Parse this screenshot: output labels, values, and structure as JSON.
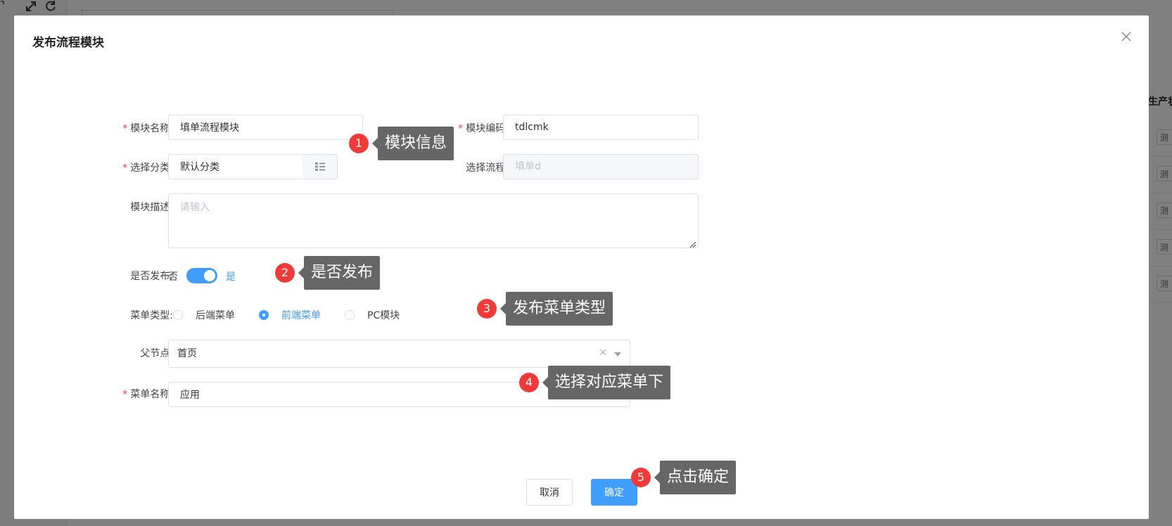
{
  "background": {
    "toolbar_icons": [
      "expand-icon",
      "refresh-icon"
    ],
    "right_column_header": "生产状",
    "right_row_tags": [
      "测",
      "测",
      "测",
      "测",
      "测"
    ]
  },
  "modal": {
    "title": "发布流程模块",
    "close_icon": "close-icon"
  },
  "form": {
    "module_name": {
      "label": "模块名称:",
      "required": true,
      "value": "填单流程模块"
    },
    "module_code": {
      "label": "模块编码:",
      "required": true,
      "value": "tdlcmk"
    },
    "category": {
      "label": "选择分类:",
      "required": true,
      "value": "默认分类",
      "append_icon": "list-icon"
    },
    "process": {
      "label": "选择流程:",
      "placeholder": "填单d",
      "disabled": true
    },
    "description": {
      "label": "模块描述:",
      "placeholder": "请输入"
    },
    "publish": {
      "label": "是否发布:",
      "off_text": "否",
      "on_text": "是",
      "on": true
    },
    "menu_type": {
      "label": "菜单类型:",
      "options": [
        "后端菜单",
        "前端菜单",
        "PC模块"
      ],
      "selected": "前端菜单"
    },
    "parent_node": {
      "label": "父节点:",
      "value": "首页"
    },
    "menu_name": {
      "label": "菜单名称:",
      "required": true,
      "value": "应用"
    }
  },
  "footer": {
    "cancel_label": "取消",
    "confirm_label": "确定"
  },
  "annotations": [
    {
      "number": "1",
      "text": "模块信息"
    },
    {
      "number": "2",
      "text": "是否发布"
    },
    {
      "number": "3",
      "text": "发布菜单类型"
    },
    {
      "number": "4",
      "text": "选择对应菜单下"
    },
    {
      "number": "5",
      "text": "点击确定"
    }
  ],
  "colors": {
    "overlay": "#808080",
    "primary": "#409eff",
    "required": "#f04040",
    "annotation_badge": "#f03a3a",
    "annotation_tag": "#666666"
  }
}
